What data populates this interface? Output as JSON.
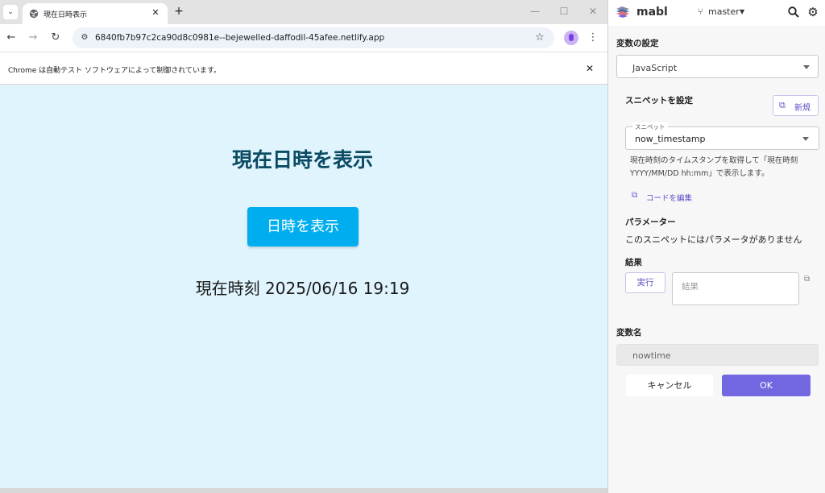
{
  "browser": {
    "tab_title": "現在日時表示",
    "url": "6840fb7b97c2ca90d8c0981e--bejewelled-daffodil-45afee.netlify.app",
    "automation_notice": "Chrome は自動テスト ソフトウェアによって制御されています。"
  },
  "page": {
    "heading": "現在日時を表示",
    "button_label": "日時を表示",
    "current_time_text": "現在時刻 2025/06/16 19:19",
    "background_color": "#dff4fd",
    "button_color": "#00aeef"
  },
  "mabl": {
    "app_name": "mabl",
    "branch": "master",
    "variable_settings": {
      "title": "変数の設定",
      "type_value": "JavaScript"
    },
    "snippet": {
      "title": "スニペットを設定",
      "new_button": "新規",
      "field_label": "スニペット",
      "selected": "now_timestamp",
      "description": "現在時刻のタイムスタンプを取得して「現在時刻 YYYY/MM/DD hh:mm」で表示します。",
      "edit_code_link": "コードを編集"
    },
    "parameters": {
      "title": "パラメーター",
      "empty_text": "このスニペットにはパラメータがありません"
    },
    "result": {
      "title": "結果",
      "run_button": "実行",
      "placeholder": "結果"
    },
    "variable_name": {
      "title": "変数名",
      "value": "nowtime"
    },
    "actions": {
      "cancel": "キャンセル",
      "ok": "OK"
    },
    "accent_color": "#7267e0"
  }
}
